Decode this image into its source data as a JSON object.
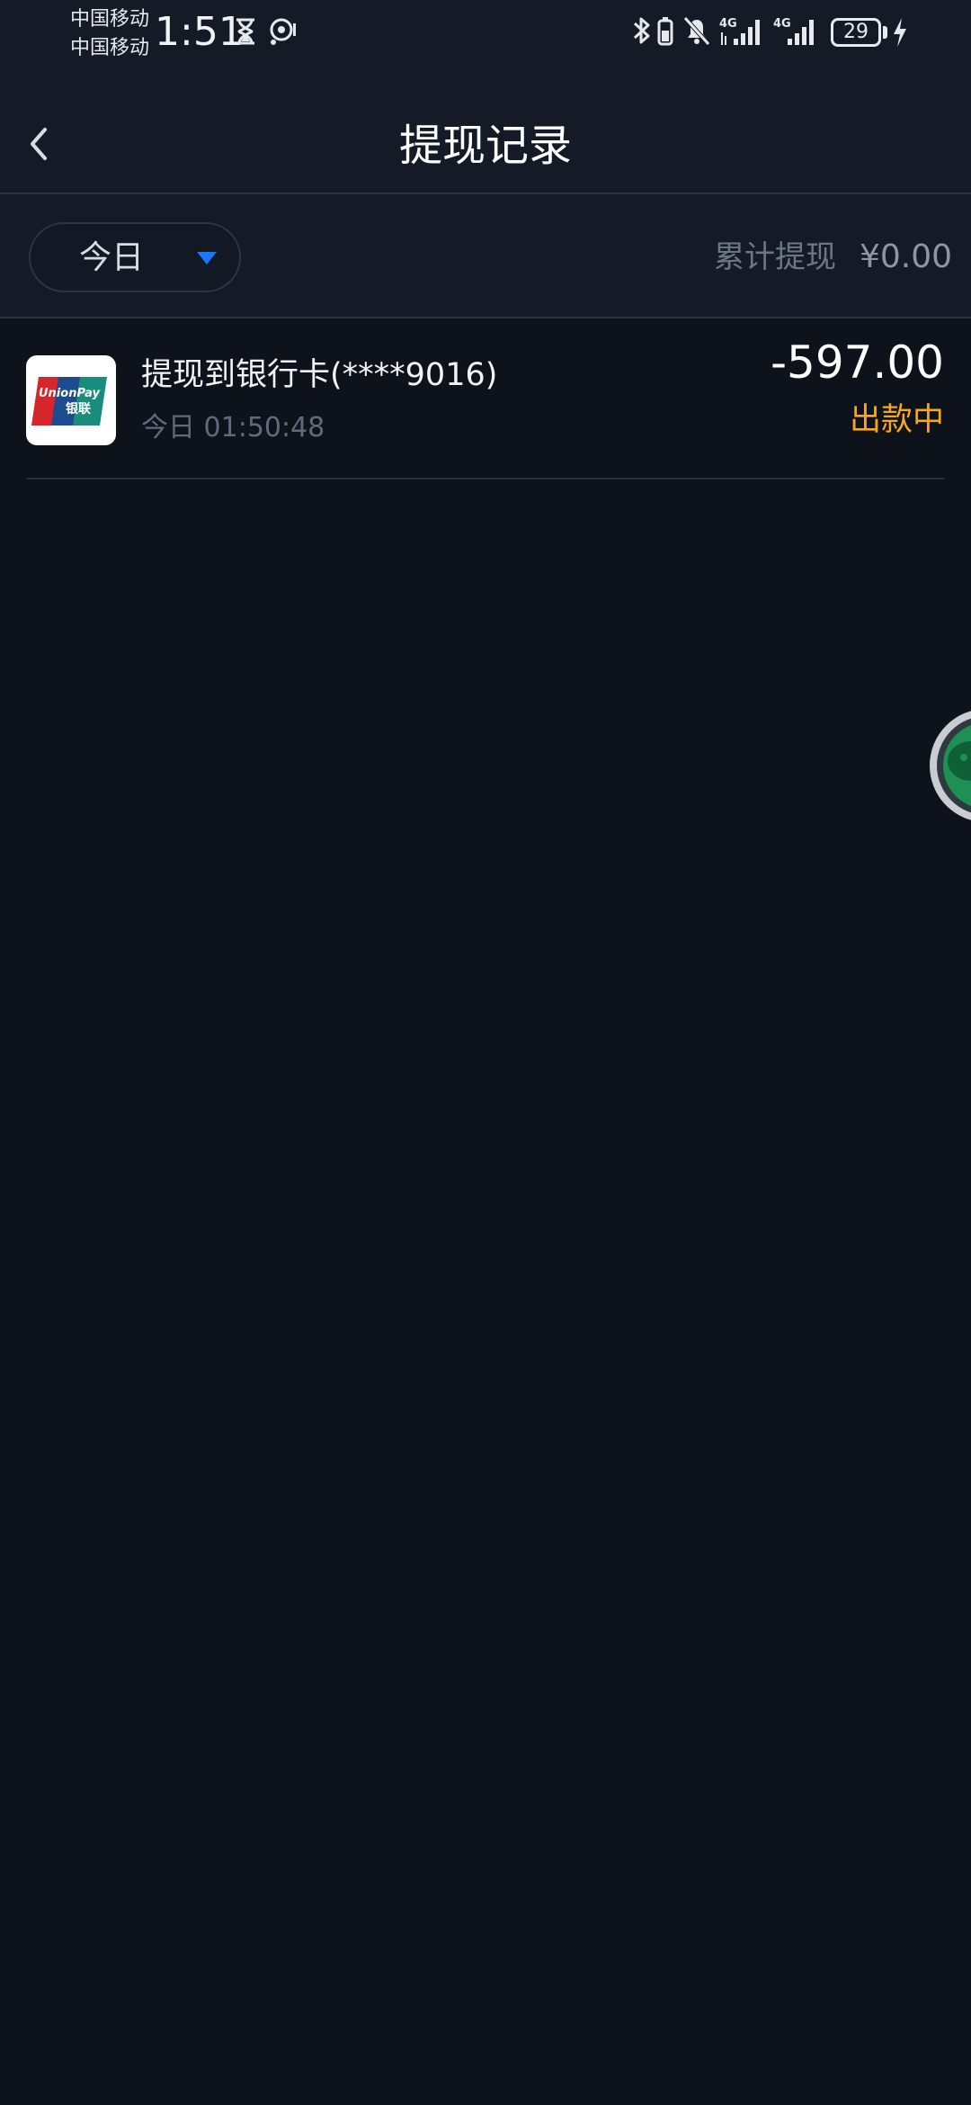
{
  "status_bar": {
    "carrier_1": "中国移动",
    "carrier_2": "中国移动",
    "time": "1:51",
    "network_1": "4G",
    "network_2": "4G",
    "battery": "29"
  },
  "header": {
    "title": "提现记录"
  },
  "filter": {
    "period": "今日",
    "total_label": "累计提现",
    "total_amount": "¥0.00"
  },
  "records": [
    {
      "title": "提现到银行卡(****9016)",
      "time": "今日 01:50:48",
      "amount": "-597.00",
      "status": "出款中"
    }
  ],
  "logo": {
    "text_top": "UnionPay",
    "text_bottom": "银联"
  },
  "colors": {
    "background": "#0e121b",
    "header_bg": "#141b27",
    "status_pending": "#f5a623",
    "accent": "#1677ff"
  }
}
